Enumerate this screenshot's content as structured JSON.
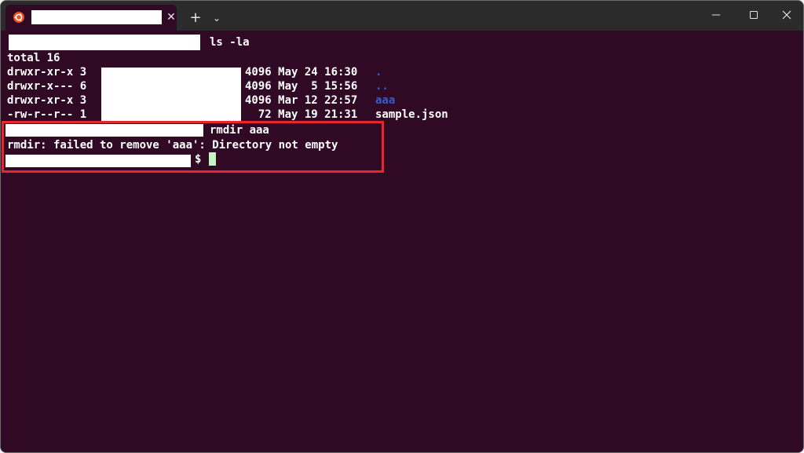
{
  "tabs": [
    {
      "icon": "ubuntu-icon",
      "title": ""
    }
  ],
  "tab_close_glyph": "✕",
  "new_tab_glyph": "+",
  "tab_dropdown_glyph": "⌄",
  "terminal": {
    "prompt1_command": "ls -la",
    "total_line": "total 16",
    "listing": [
      {
        "perms": "drwxr-xr-x 3",
        "size_date": "4096 May 24 16:30",
        "name": "."
      },
      {
        "perms": "drwxr-x--- 6",
        "size_date": "4096 May  5 15:56",
        "name": ".."
      },
      {
        "perms": "drwxr-xr-x 3",
        "size_date": "4096 Mar 12 22:57",
        "name": "aaa"
      },
      {
        "perms": "-rw-r--r-- 1",
        "size_date": "  72 May 19 21:31",
        "name": "sample.json"
      }
    ],
    "prompt2_command": "rmdir aaa",
    "error_line": "rmdir: failed to remove 'aaa': Directory not empty",
    "prompt3_symbol": "$"
  },
  "colors": {
    "terminal_bg": "#300a24",
    "titlebar_bg": "#2b2b2b",
    "dir_link": "#2f5fd0",
    "highlight": "#e8262c"
  }
}
